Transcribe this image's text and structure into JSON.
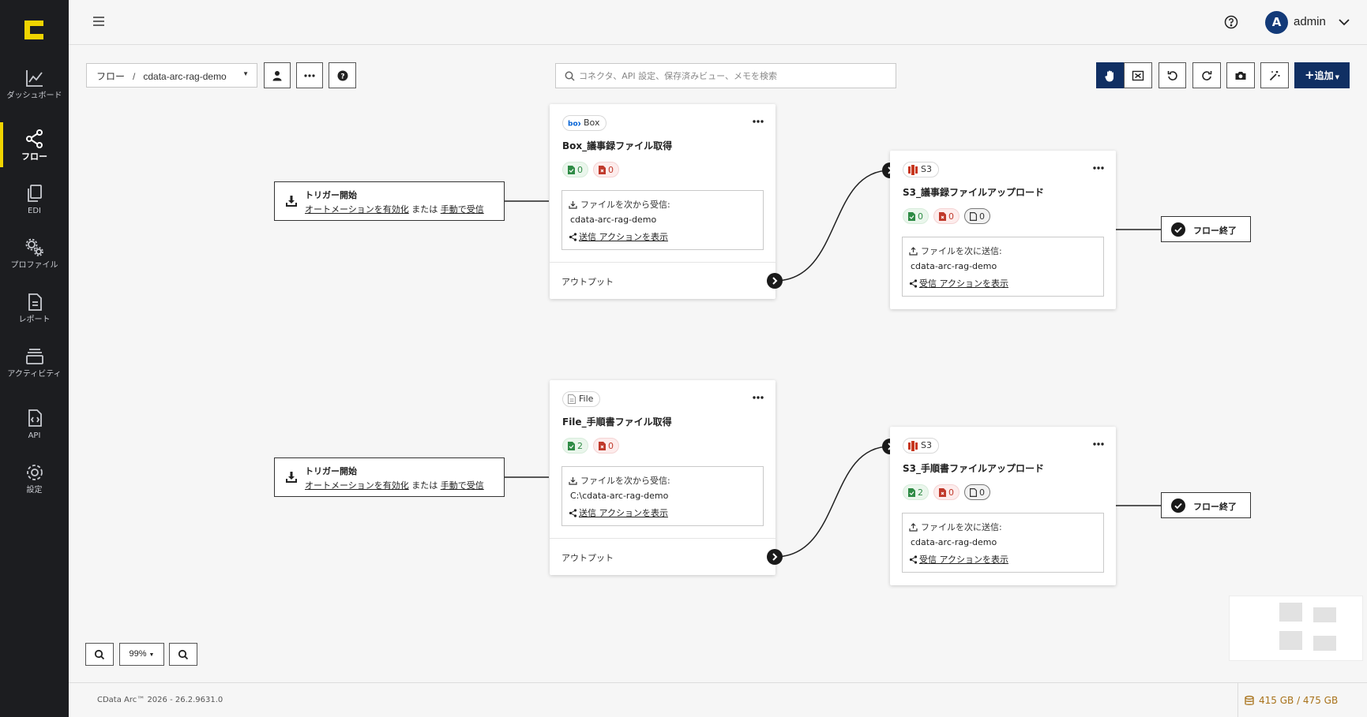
{
  "colors": {
    "accent": "#f0d400",
    "navy": "#102f63",
    "sidebar": "#1c1d20",
    "success": "#2e8b45",
    "error": "#c0392b",
    "storage": "#a8721a"
  },
  "sidebar": {
    "logo": "cdata-logo",
    "items": [
      {
        "label": "ダッシュボード",
        "icon": "chart-line-icon",
        "active": false
      },
      {
        "label": "フロー",
        "icon": "share-nodes-icon",
        "active": true
      },
      {
        "label": "EDI",
        "icon": "documents-icon",
        "active": false
      },
      {
        "label": "プロファイル",
        "icon": "gears-icon",
        "active": false
      },
      {
        "label": "レポート",
        "icon": "report-icon",
        "active": false
      },
      {
        "label": "アクティビティ",
        "icon": "activity-stack-icon",
        "active": false
      },
      {
        "label": "API",
        "icon": "api-file-icon",
        "active": false
      },
      {
        "label": "設定",
        "icon": "gear-icon",
        "active": false
      }
    ]
  },
  "header": {
    "avatar_initial": "A",
    "username": "admin"
  },
  "toolbar": {
    "breadcrumb_root": "フロー",
    "breadcrumb_sep": "/",
    "breadcrumb_current": "cdata-arc-rag-demo",
    "search_placeholder": "コネクタ、API 設定、保存済みビュー、メモを検索",
    "add_label": "追加"
  },
  "flows": [
    {
      "trigger": {
        "title": "トリガー開始",
        "link1": "オートメーションを有効化",
        "or": "または",
        "link2": "手動で受信"
      },
      "source": {
        "badge": "Box",
        "badge_icon": "box-logo-icon",
        "title": "Box_議事録ファイル取得",
        "success": "0",
        "error": "0",
        "info_label": "ファイルを次から受信:",
        "info_value": "cdata-arc-rag-demo",
        "action": "送信 アクションを表示",
        "output_label": "アウトプット"
      },
      "target": {
        "badge": "S3",
        "badge_icon": "s3-logo-icon",
        "title": "S3_議事録ファイルアップロード",
        "success": "0",
        "error": "0",
        "pending": "0",
        "info_label": "ファイルを次に送信:",
        "info_value": "cdata-arc-rag-demo",
        "action": "受信 アクションを表示"
      },
      "end": "フロー終了"
    },
    {
      "trigger": {
        "title": "トリガー開始",
        "link1": "オートメーションを有効化",
        "or": "または",
        "link2": "手動で受信"
      },
      "source": {
        "badge": "File",
        "badge_icon": "file-icon",
        "title": "File_手順書ファイル取得",
        "success": "2",
        "error": "0",
        "info_label": "ファイルを次から受信:",
        "info_value": "C:\\cdata-arc-rag-demo",
        "action": "送信 アクションを表示",
        "output_label": "アウトプット"
      },
      "target": {
        "badge": "S3",
        "badge_icon": "s3-logo-icon",
        "title": "S3_手順書ファイルアップロード",
        "success": "2",
        "error": "0",
        "pending": "0",
        "info_label": "ファイルを次に送信:",
        "info_value": "cdata-arc-rag-demo",
        "action": "受信 アクションを表示"
      },
      "end": "フロー終了"
    }
  ],
  "zoom": {
    "level": "99%"
  },
  "footer": {
    "version": "CData Arc™ 2026 - 26.2.9631.0",
    "storage": "415 GB / 475 GB"
  }
}
